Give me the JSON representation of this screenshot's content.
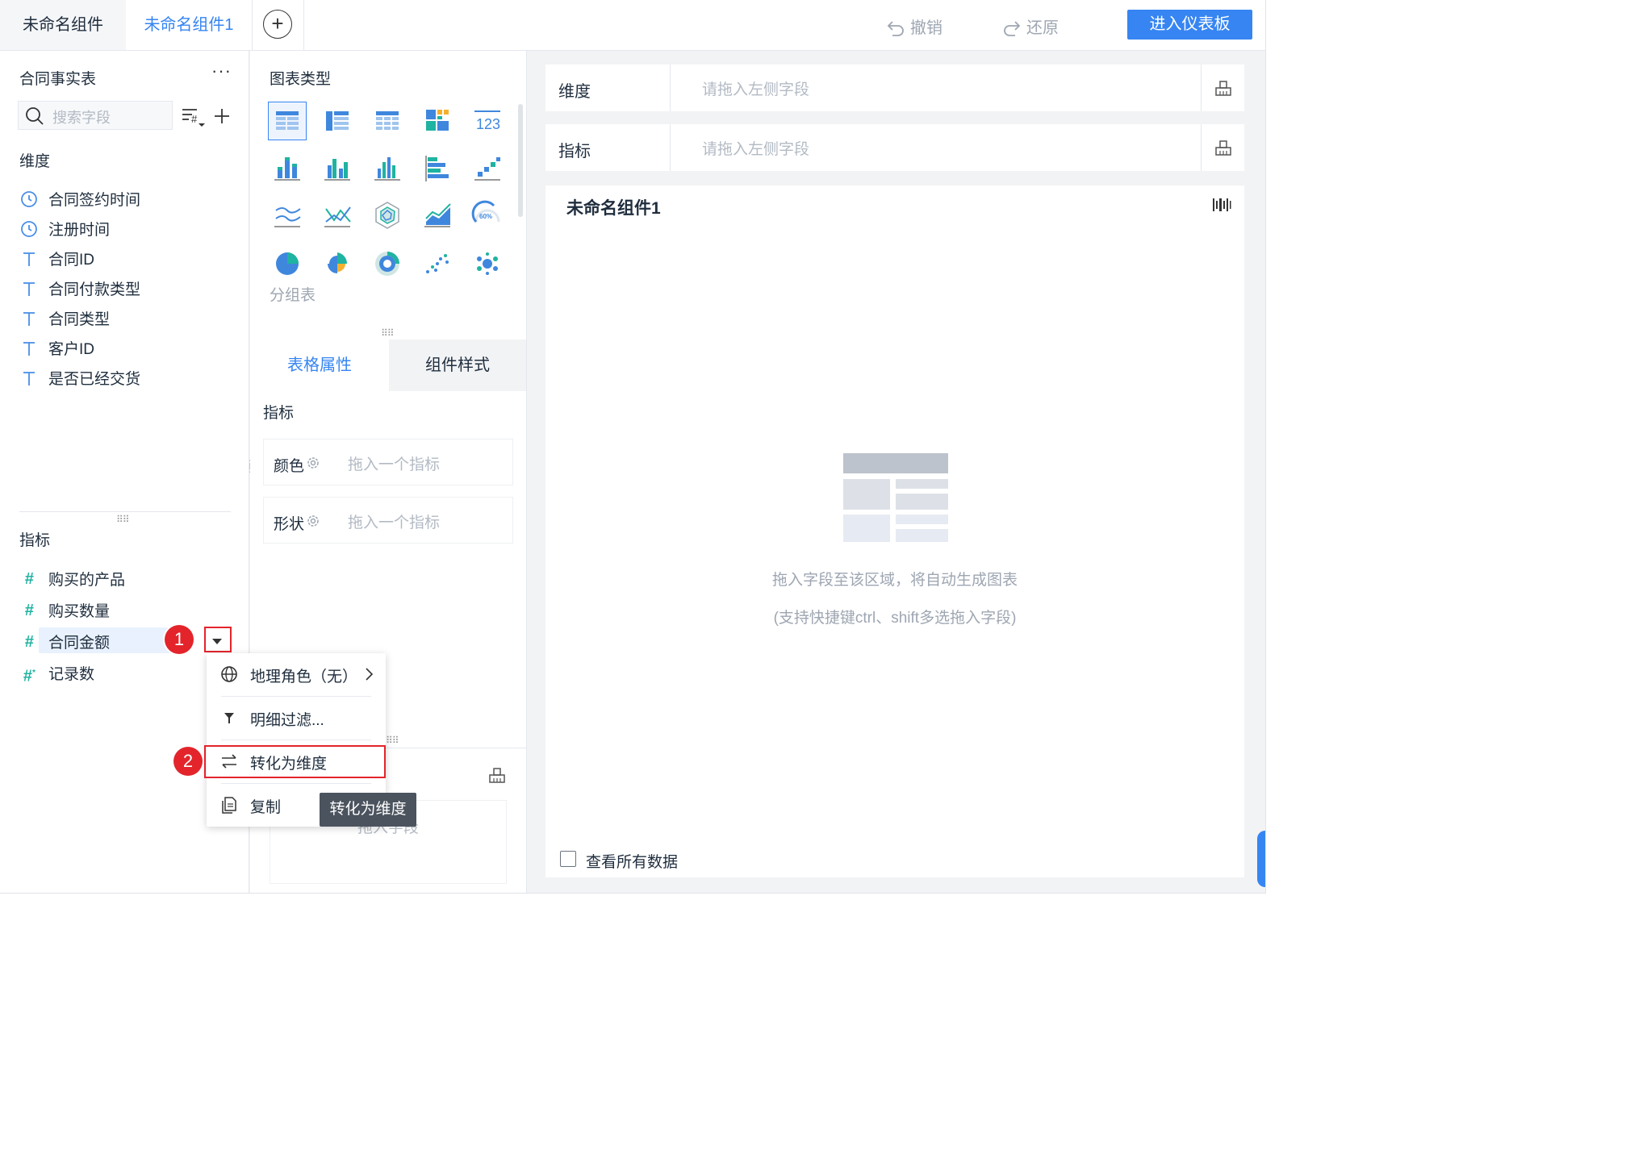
{
  "tabs": {
    "tab1": "未命名组件",
    "tab2": "未命名组件1",
    "add": "+"
  },
  "toolbar": {
    "undo": "撤销",
    "redo": "还原",
    "enter_dashboard": "进入仪表板"
  },
  "left": {
    "table_name": "合同事实表",
    "more": "···",
    "search_placeholder": "搜索字段",
    "dimension_label": "维度",
    "dimensions": [
      {
        "icon": "clock-icon",
        "label": "合同签约时间"
      },
      {
        "icon": "clock-icon",
        "label": "注册时间"
      },
      {
        "icon": "text-type-icon",
        "label": "合同ID"
      },
      {
        "icon": "text-type-icon",
        "label": "合同付款类型"
      },
      {
        "icon": "text-type-icon",
        "label": "合同类型"
      },
      {
        "icon": "text-type-icon",
        "label": "客户ID"
      },
      {
        "icon": "text-type-icon",
        "label": "是否已经交货"
      }
    ],
    "measure_label": "指标",
    "measures": [
      {
        "icon": "hash-icon",
        "label": "购买的产品"
      },
      {
        "icon": "hash-icon",
        "label": "购买数量"
      },
      {
        "icon": "hash-icon",
        "label": "合同金额"
      },
      {
        "icon": "hash-star-icon",
        "label": "记录数"
      }
    ]
  },
  "middle": {
    "chart_type_label": "图表类型",
    "selected_chart": "分组表",
    "tabs": {
      "table_props": "表格属性",
      "component_style": "组件样式"
    },
    "measure_label": "指标",
    "color_label": "颜色",
    "shape_label": "形状",
    "drop_placeholder": "拖入一个指标",
    "lower_placeholder": "拖入字段"
  },
  "right": {
    "dimension_label": "维度",
    "measure_label": "指标",
    "drop_placeholder": "请拖入左侧字段",
    "canvas_title": "未命名组件1",
    "hint1": "拖入字段至该区域，将自动生成图表",
    "hint2": "(支持快捷键ctrl、shift多选拖入字段)",
    "view_all": "查看所有数据"
  },
  "menu": {
    "geo_role": "地理角色（无）",
    "detail_filter": "明细过滤...",
    "convert": "转化为维度",
    "copy": "复制"
  },
  "tooltip": "转化为维度",
  "badges": {
    "one": "1",
    "two": "2"
  },
  "colors": {
    "accent": "#3685f2",
    "highlight": "#e3242b",
    "measure": "#1fb3a1"
  }
}
